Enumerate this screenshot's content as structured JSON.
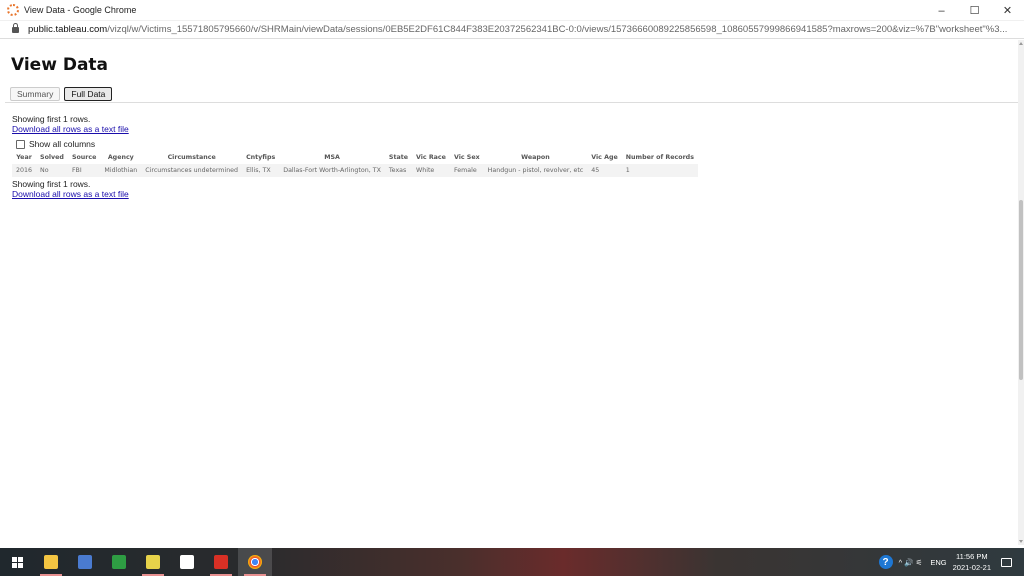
{
  "window": {
    "title": "View Data - Google Chrome",
    "url_host": "public.tableau.com",
    "url_path": "/vizql/w/Victims_15571805795660/v/SHRMain/viewData/sessions/0EB5E2DF61C844F383E20372562341BC-0:0/views/15736660089225856598_10860557999866941585?maxrows=200&viz=%7B\"worksheet\"%3...",
    "minimize": "–",
    "maximize": "☐",
    "close": "✕"
  },
  "page": {
    "title": "View Data",
    "tabs": [
      {
        "label": "Summary",
        "active": false
      },
      {
        "label": "Full Data",
        "active": true
      }
    ],
    "showing_top": "Showing first 1 rows.",
    "download_top": "Download all rows as a text file",
    "show_all_columns": "Show all columns",
    "showing_bottom": "Showing first 1 rows.",
    "download_bottom": "Download all rows as a text file"
  },
  "table": {
    "columns": [
      "Year",
      "Solved",
      "Source",
      "Agency",
      "Circumstance",
      "Cntyfips",
      "MSA",
      "State",
      "Vic Race",
      "Vic Sex",
      "Weapon",
      "Vic Age",
      "Number of Records"
    ],
    "rows": [
      [
        "2016",
        "No",
        "FBI",
        "Midlothian",
        "Circumstances undetermined",
        "Ellis, TX",
        "Dallas-Fort Worth-Arlington, TX",
        "Texas",
        "White",
        "Female",
        "Handgun - pistol, revolver, etc",
        "45",
        "1"
      ]
    ]
  },
  "taskbar": {
    "apps": [
      "start",
      "file-explorer",
      "calculator",
      "money-app",
      "paint-app",
      "document-app",
      "gmail-app",
      "chrome-app"
    ],
    "language": "ENG",
    "time": "11:56 PM",
    "date": "2021-02-21",
    "tray_icons": "^  🔊  ⚟"
  },
  "colors": {
    "link": "#1a0dab",
    "taskbar_indicator": "#e89090",
    "help_blue": "#1e77d3"
  }
}
